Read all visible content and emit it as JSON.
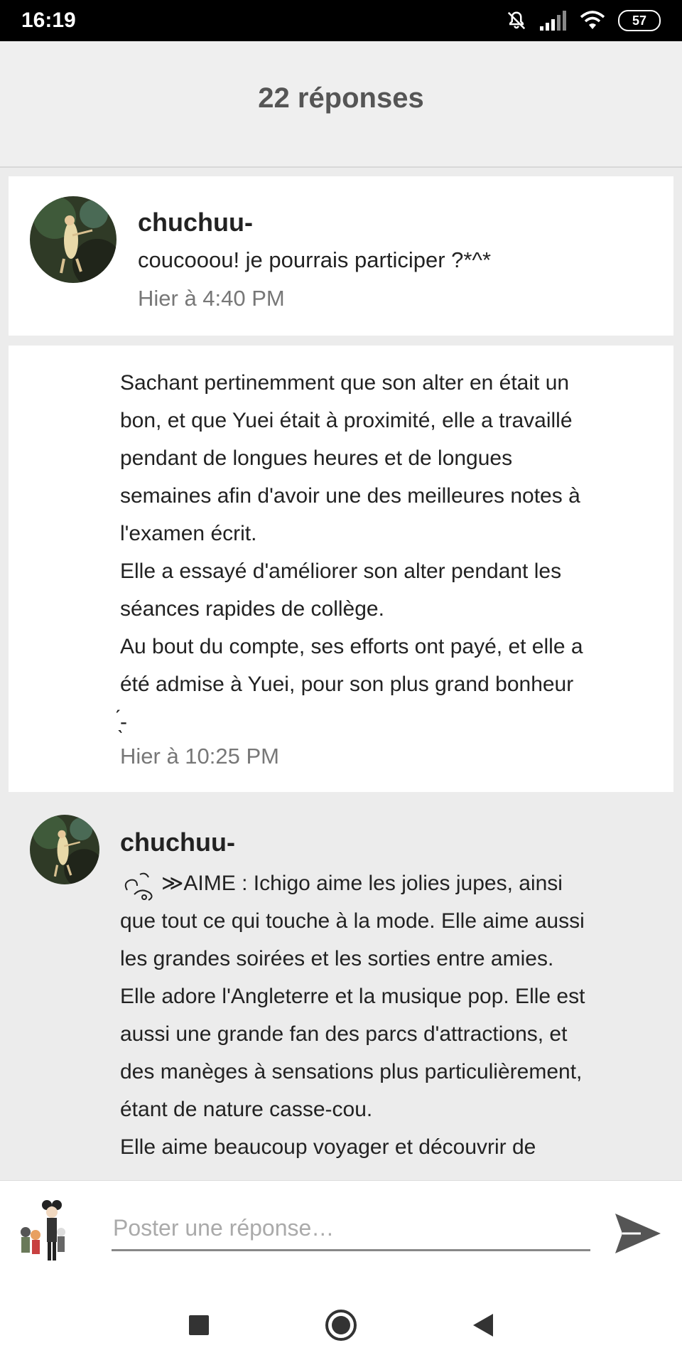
{
  "status_bar": {
    "time": "16:19",
    "battery": "57",
    "icons": [
      "bell-muted-icon",
      "signal-icon",
      "wifi-icon",
      "battery-icon"
    ]
  },
  "header": {
    "title": "22 réponses"
  },
  "replies": [
    {
      "username": "chuchuu-",
      "text": "coucooou! je pourrais participer ?*^*",
      "timestamp": "Hier à 4:40 PM"
    },
    {
      "text": "Sachant pertinemment que son alter en était un\nbon, et que Yuei était à proximité, elle a travaillé\npendant de longues heures et de longues\nsemaines afin d'avoir une des meilleures notes à\nl'examen écrit.\nElle a essayé d'améliorer son alter pendant les\nséances rapides de collège.\nAu bout du compte, ses efforts ont payé, et elle a\nété admise à Yuei, pour son plus grand bonheur\n ̖́-",
      "timestamp": "Hier à 10:25 PM"
    },
    {
      "username": "chuchuu-",
      "text": "≫AIME : Ichigo aime les jolies jupes, ainsi\nque tout ce qui touche à la mode. Elle aime aussi\nles grandes soirées et les sorties entre amies.\nElle adore l'Angleterre et la musique pop. Elle est\naussi une grande fan des parcs d'attractions, et\ndes manèges à sensations plus particulièrement,\nétant de nature casse-cou.\nElle aime beaucoup voyager et découvrir de"
    }
  ],
  "composer": {
    "placeholder": "Poster une réponse…"
  },
  "nav_bar": {
    "icons": [
      "recents-square-icon",
      "home-circle-icon",
      "back-triangle-icon"
    ]
  },
  "colors": {
    "status_bg": "#000000",
    "header_bg": "#efefef",
    "card_bg": "#ffffff",
    "page_bg": "#ececec"
  }
}
